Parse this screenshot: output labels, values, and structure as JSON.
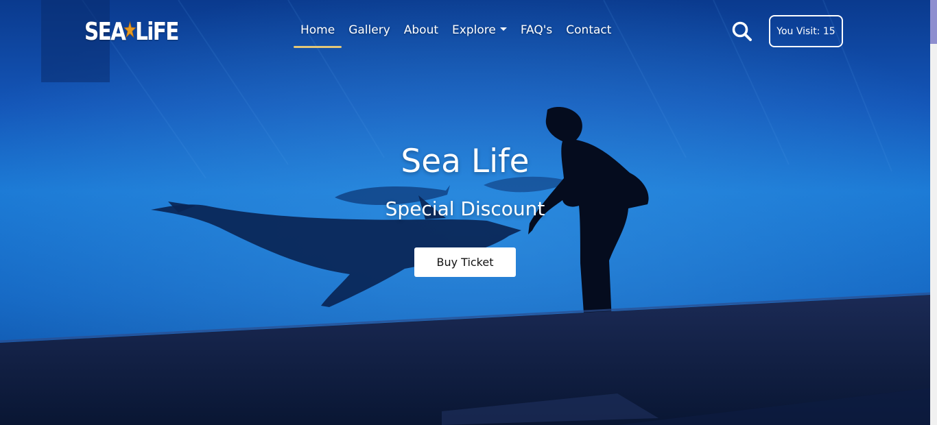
{
  "navbar": {
    "logo_text_left": "SEA",
    "logo_text_right": "LiFE",
    "links": [
      {
        "label": "Home",
        "active": true
      },
      {
        "label": "Gallery"
      },
      {
        "label": "About"
      },
      {
        "label": "Explore"
      },
      {
        "label": "FAQ's"
      },
      {
        "label": "Contact"
      }
    ],
    "visit_counter": "You Visit: 15"
  },
  "hero": {
    "title": "Sea Life",
    "subtitle": "Special Discount",
    "cta_label": "Buy Ticket"
  },
  "icons": {
    "logo_star": "starfish-icon",
    "search": "search-icon",
    "dropdown": "caret-down-icon"
  },
  "colors": {
    "active_underline": "#e4c878",
    "water": "#1565c0",
    "floor": "#0b1a40"
  }
}
